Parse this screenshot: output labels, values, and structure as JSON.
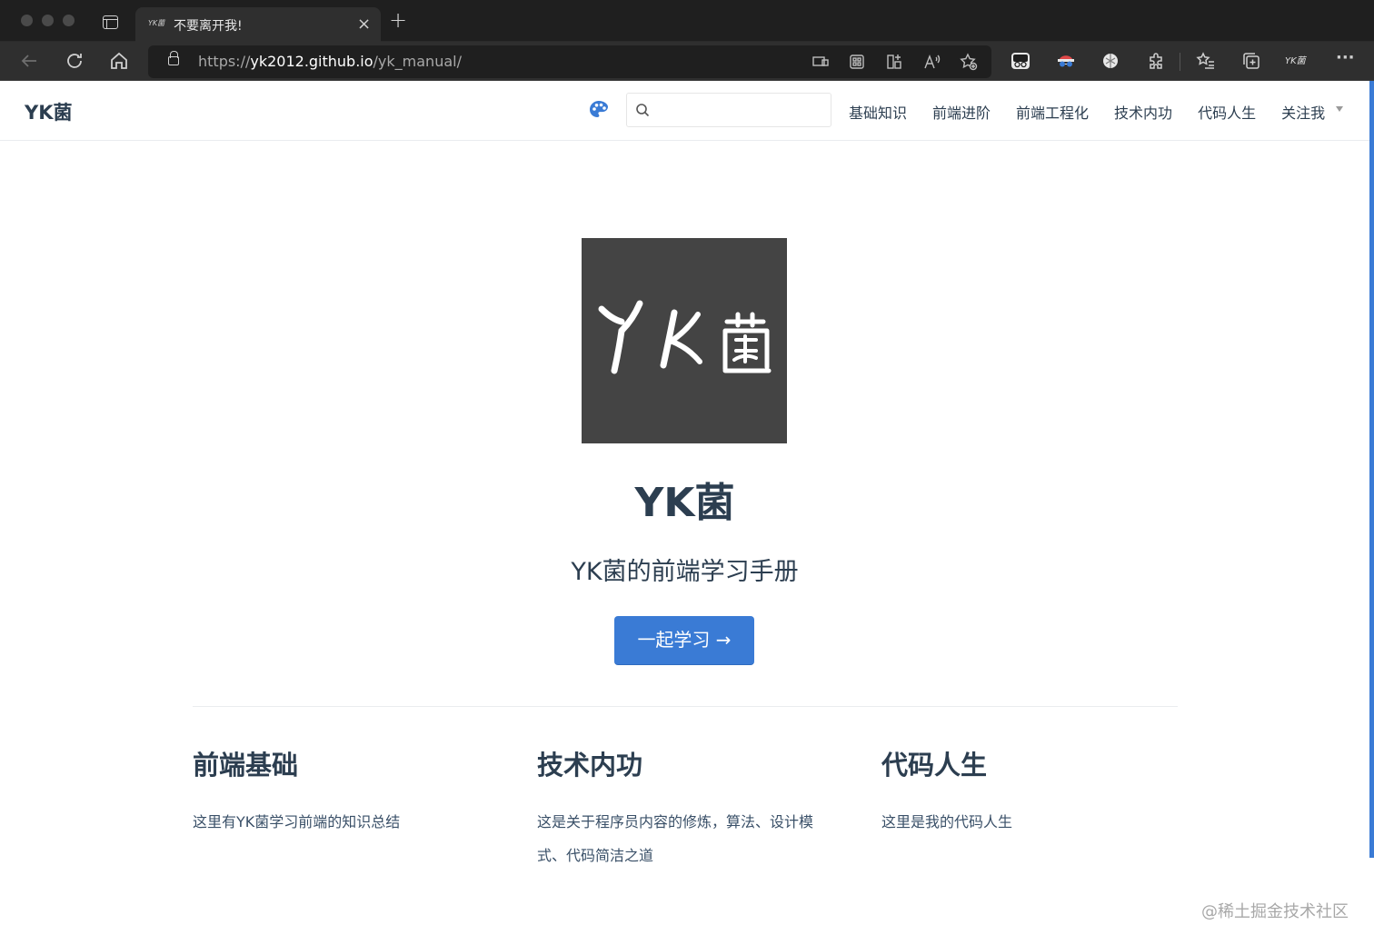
{
  "browser": {
    "tab_title": "不要离开我!",
    "tab_favicon_text": "YK菌",
    "url_scheme": "https://",
    "url_host": "yk2012.github.io",
    "url_path": "/yk_manual/",
    "profile_text": "YK菌"
  },
  "navbar": {
    "site_name": "YK菌",
    "search_placeholder": "",
    "links": [
      "基础知识",
      "前端进阶",
      "前端工程化",
      "技术内功",
      "代码人生",
      "关注我"
    ]
  },
  "hero": {
    "logo_text": "YK菌",
    "title": "YK菌",
    "description": "YK菌的前端学习手册",
    "action_text": "一起学习 →"
  },
  "features": [
    {
      "title": "前端基础",
      "details": "这里有YK菌学习前端的知识总结"
    },
    {
      "title": "技术内功",
      "details": "这是关于程序员内容的修炼，算法、设计模式、代码简洁之道"
    },
    {
      "title": "代码人生",
      "details": "这里是我的代码人生"
    }
  ],
  "watermark": "@稀土掘金技术社区",
  "colors": {
    "accent": "#3a7bd5",
    "text": "#2c3e50",
    "logo_bg": "#444444"
  }
}
